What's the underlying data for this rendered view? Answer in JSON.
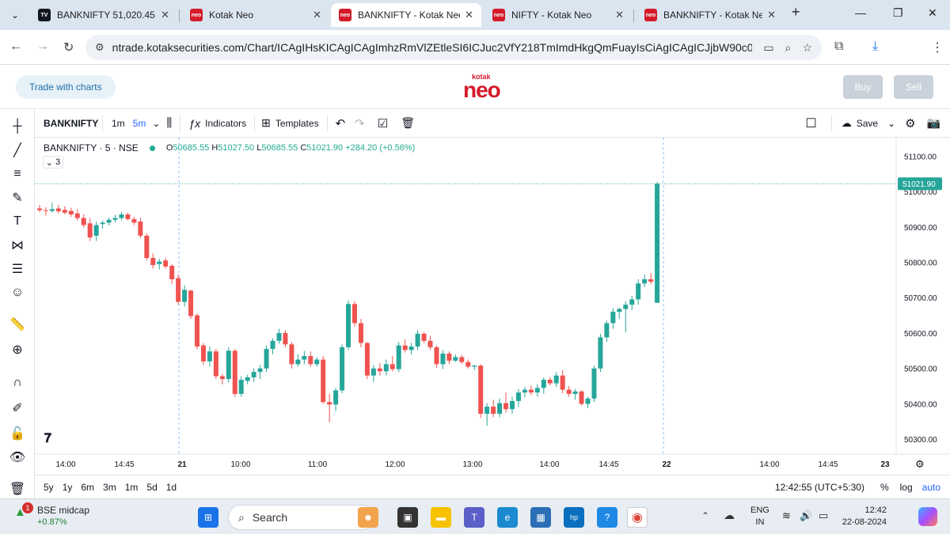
{
  "browser": {
    "tabs": [
      {
        "label": "BANKNIFTY 51,020.45 ▲",
        "icon": "tradingview-favicon",
        "active": false
      },
      {
        "label": "Kotak Neo",
        "icon": "kotak-neo-favicon",
        "active": false
      },
      {
        "label": "BANKNIFTY - Kotak Neo",
        "icon": "kotak-neo-favicon",
        "active": true
      },
      {
        "label": "NIFTY - Kotak Neo",
        "icon": "kotak-neo-favicon",
        "active": false
      },
      {
        "label": "BANKNIFTY - Kotak Neo",
        "icon": "kotak-neo-favicon",
        "active": false
      }
    ],
    "url": "ntrade.kotaksecurities.com/Chart/ICAgIHsKICAgICAgImhzRmVlZEtleSI6ICJuc2VfY218TmImdHkgQmFuayIsCiAgICAgICJjbW90c0NvZGUi..."
  },
  "app": {
    "trade_with_charts": "Trade with charts",
    "logo_small": "kotak",
    "logo_big": "neo",
    "buy_label": "Buy",
    "sell_label": "Sell"
  },
  "toolbar": {
    "symbol": "BANKNIFTY",
    "interval_1m": "1m",
    "interval_5m": "5m",
    "indicators": "Indicators",
    "templates": "Templates",
    "save": "Save"
  },
  "legend": {
    "title": "BANKNIFTY · 5 · NSE",
    "open_label": "O",
    "open": "50685.55",
    "high_label": "H",
    "high": "51027.50",
    "low_label": "L",
    "low": "50685.55",
    "close_label": "C",
    "close": "51021.90",
    "change": "+284.20 (+0.56%)",
    "collapsed_count": "3"
  },
  "bottom": {
    "ranges": [
      "5y",
      "1y",
      "6m",
      "3m",
      "1m",
      "5d",
      "1d"
    ],
    "clock": "12:42:55 (UTC+5:30)",
    "percent": "%",
    "log": "log",
    "auto": "auto"
  },
  "chart_data": {
    "type": "candlestick",
    "symbol": "BANKNIFTY",
    "interval": "5",
    "exchange": "NSE",
    "last_price_label": "51021.90",
    "y_ticks": [
      51100,
      51000,
      50900,
      50800,
      50700,
      50600,
      50500,
      50400,
      50300
    ],
    "ylim": [
      50258,
      51152
    ],
    "x_ticks": [
      "14:00",
      "14:45",
      "21",
      "10:00",
      "11:00",
      "12:00",
      "13:00",
      "14:00",
      "14:45",
      "22",
      "14:00",
      "14:45",
      "23"
    ],
    "up_color": "#26a69a",
    "down_color": "#ef5350",
    "candles": [
      {
        "o": 50952,
        "h": 50962,
        "l": 50942,
        "c": 50947
      },
      {
        "o": 50947,
        "h": 50955,
        "l": 50932,
        "c": 50945
      },
      {
        "o": 50945,
        "h": 50968,
        "l": 50940,
        "c": 50950
      },
      {
        "o": 50952,
        "h": 50962,
        "l": 50938,
        "c": 50944
      },
      {
        "o": 50948,
        "h": 50958,
        "l": 50935,
        "c": 50940
      },
      {
        "o": 50945,
        "h": 50954,
        "l": 50928,
        "c": 50935
      },
      {
        "o": 50938,
        "h": 50950,
        "l": 50918,
        "c": 50925
      },
      {
        "o": 50925,
        "h": 50935,
        "l": 50898,
        "c": 50905
      },
      {
        "o": 50910,
        "h": 50925,
        "l": 50860,
        "c": 50870
      },
      {
        "o": 50875,
        "h": 50915,
        "l": 50860,
        "c": 50905
      },
      {
        "o": 50908,
        "h": 50918,
        "l": 50895,
        "c": 50912
      },
      {
        "o": 50912,
        "h": 50926,
        "l": 50904,
        "c": 50920
      },
      {
        "o": 50920,
        "h": 50934,
        "l": 50912,
        "c": 50925
      },
      {
        "o": 50925,
        "h": 50942,
        "l": 50918,
        "c": 50935
      },
      {
        "o": 50935,
        "h": 50940,
        "l": 50918,
        "c": 50922
      },
      {
        "o": 50922,
        "h": 50928,
        "l": 50905,
        "c": 50912
      },
      {
        "o": 50915,
        "h": 50926,
        "l": 50868,
        "c": 50875
      },
      {
        "o": 50875,
        "h": 50882,
        "l": 50805,
        "c": 50812
      },
      {
        "o": 50812,
        "h": 50825,
        "l": 50782,
        "c": 50792
      },
      {
        "o": 50795,
        "h": 50810,
        "l": 50780,
        "c": 50802
      },
      {
        "o": 50805,
        "h": 50812,
        "l": 50782,
        "c": 50788
      },
      {
        "o": 50790,
        "h": 50795,
        "l": 50738,
        "c": 50752
      },
      {
        "o": 50755,
        "h": 50765,
        "l": 50680,
        "c": 50688
      },
      {
        "o": 50688,
        "h": 50735,
        "l": 50675,
        "c": 50722
      },
      {
        "o": 50720,
        "h": 50722,
        "l": 50640,
        "c": 50648
      },
      {
        "o": 50650,
        "h": 50655,
        "l": 50555,
        "c": 50562
      },
      {
        "o": 50565,
        "h": 50572,
        "l": 50510,
        "c": 50520
      },
      {
        "o": 50520,
        "h": 50562,
        "l": 50505,
        "c": 50548
      },
      {
        "o": 50548,
        "h": 50555,
        "l": 50470,
        "c": 50478
      },
      {
        "o": 50478,
        "h": 50485,
        "l": 50455,
        "c": 50470
      },
      {
        "o": 50470,
        "h": 50560,
        "l": 50460,
        "c": 50550
      },
      {
        "o": 50550,
        "h": 50555,
        "l": 50420,
        "c": 50428
      },
      {
        "o": 50428,
        "h": 50478,
        "l": 50420,
        "c": 50468
      },
      {
        "o": 50465,
        "h": 50482,
        "l": 50455,
        "c": 50475
      },
      {
        "o": 50475,
        "h": 50500,
        "l": 50462,
        "c": 50490
      },
      {
        "o": 50490,
        "h": 50510,
        "l": 50470,
        "c": 50500
      },
      {
        "o": 50500,
        "h": 50565,
        "l": 50490,
        "c": 50555
      },
      {
        "o": 50555,
        "h": 50585,
        "l": 50540,
        "c": 50578
      },
      {
        "o": 50578,
        "h": 50612,
        "l": 50570,
        "c": 50600
      },
      {
        "o": 50600,
        "h": 50608,
        "l": 50560,
        "c": 50568
      },
      {
        "o": 50568,
        "h": 50575,
        "l": 50500,
        "c": 50512
      },
      {
        "o": 50512,
        "h": 50540,
        "l": 50505,
        "c": 50525
      },
      {
        "o": 50525,
        "h": 50550,
        "l": 50512,
        "c": 50535
      },
      {
        "o": 50535,
        "h": 50548,
        "l": 50505,
        "c": 50512
      },
      {
        "o": 50512,
        "h": 50532,
        "l": 50505,
        "c": 50525
      },
      {
        "o": 50525,
        "h": 50535,
        "l": 50400,
        "c": 50405
      },
      {
        "o": 50405,
        "h": 50428,
        "l": 50348,
        "c": 50398
      },
      {
        "o": 50398,
        "h": 50445,
        "l": 50380,
        "c": 50438
      },
      {
        "o": 50438,
        "h": 50568,
        "l": 50430,
        "c": 50560
      },
      {
        "o": 50560,
        "h": 50692,
        "l": 50552,
        "c": 50682
      },
      {
        "o": 50682,
        "h": 50690,
        "l": 50618,
        "c": 50628
      },
      {
        "o": 50628,
        "h": 50640,
        "l": 50560,
        "c": 50572
      },
      {
        "o": 50572,
        "h": 50575,
        "l": 50470,
        "c": 50480
      },
      {
        "o": 50480,
        "h": 50510,
        "l": 50462,
        "c": 50500
      },
      {
        "o": 50500,
        "h": 50515,
        "l": 50480,
        "c": 50492
      },
      {
        "o": 50492,
        "h": 50525,
        "l": 50480,
        "c": 50512
      },
      {
        "o": 50512,
        "h": 50535,
        "l": 50492,
        "c": 50498
      },
      {
        "o": 50498,
        "h": 50575,
        "l": 50490,
        "c": 50565
      },
      {
        "o": 50565,
        "h": 50582,
        "l": 50545,
        "c": 50552
      },
      {
        "o": 50552,
        "h": 50572,
        "l": 50540,
        "c": 50562
      },
      {
        "o": 50562,
        "h": 50608,
        "l": 50552,
        "c": 50598
      },
      {
        "o": 50598,
        "h": 50602,
        "l": 50572,
        "c": 50578
      },
      {
        "o": 50578,
        "h": 50592,
        "l": 50552,
        "c": 50560
      },
      {
        "o": 50560,
        "h": 50565,
        "l": 50502,
        "c": 50512
      },
      {
        "o": 50512,
        "h": 50552,
        "l": 50498,
        "c": 50542
      },
      {
        "o": 50542,
        "h": 50548,
        "l": 50512,
        "c": 50522
      },
      {
        "o": 50522,
        "h": 50540,
        "l": 50518,
        "c": 50532
      },
      {
        "o": 50532,
        "h": 50538,
        "l": 50512,
        "c": 50518
      },
      {
        "o": 50518,
        "h": 50525,
        "l": 50500,
        "c": 50505
      },
      {
        "o": 50505,
        "h": 50510,
        "l": 50495,
        "c": 50508
      },
      {
        "o": 50508,
        "h": 50512,
        "l": 50360,
        "c": 50372
      },
      {
        "o": 50372,
        "h": 50402,
        "l": 50338,
        "c": 50392
      },
      {
        "o": 50392,
        "h": 50412,
        "l": 50362,
        "c": 50372
      },
      {
        "o": 50372,
        "h": 50415,
        "l": 50362,
        "c": 50402
      },
      {
        "o": 50402,
        "h": 50432,
        "l": 50375,
        "c": 50385
      },
      {
        "o": 50385,
        "h": 50420,
        "l": 50372,
        "c": 50408
      },
      {
        "o": 50408,
        "h": 50442,
        "l": 50392,
        "c": 50432
      },
      {
        "o": 50432,
        "h": 50448,
        "l": 50418,
        "c": 50440
      },
      {
        "o": 50440,
        "h": 50452,
        "l": 50425,
        "c": 50432
      },
      {
        "o": 50432,
        "h": 50455,
        "l": 50420,
        "c": 50445
      },
      {
        "o": 50445,
        "h": 50475,
        "l": 50428,
        "c": 50468
      },
      {
        "o": 50468,
        "h": 50475,
        "l": 50452,
        "c": 50458
      },
      {
        "o": 50458,
        "h": 50490,
        "l": 50448,
        "c": 50480
      },
      {
        "o": 50480,
        "h": 50495,
        "l": 50430,
        "c": 50440
      },
      {
        "o": 50440,
        "h": 50450,
        "l": 50420,
        "c": 50428
      },
      {
        "o": 50428,
        "h": 50442,
        "l": 50412,
        "c": 50435
      },
      {
        "o": 50435,
        "h": 50438,
        "l": 50395,
        "c": 50400
      },
      {
        "o": 50400,
        "h": 50420,
        "l": 50388,
        "c": 50415
      },
      {
        "o": 50415,
        "h": 50508,
        "l": 50405,
        "c": 50500
      },
      {
        "o": 50500,
        "h": 50598,
        "l": 50490,
        "c": 50588
      },
      {
        "o": 50588,
        "h": 50635,
        "l": 50575,
        "c": 50628
      },
      {
        "o": 50628,
        "h": 50670,
        "l": 50612,
        "c": 50660
      },
      {
        "o": 50660,
        "h": 50672,
        "l": 50640,
        "c": 50668
      },
      {
        "o": 50668,
        "h": 50690,
        "l": 50602,
        "c": 50680
      },
      {
        "o": 50680,
        "h": 50705,
        "l": 50665,
        "c": 50695
      },
      {
        "o": 50695,
        "h": 50752,
        "l": 50680,
        "c": 50740
      },
      {
        "o": 50740,
        "h": 50765,
        "l": 50730,
        "c": 50752
      },
      {
        "o": 50752,
        "h": 50770,
        "l": 50738,
        "c": 50745
      },
      {
        "o": 50685.55,
        "h": 51027.5,
        "l": 50685.55,
        "c": 51021.9
      }
    ]
  }
}
